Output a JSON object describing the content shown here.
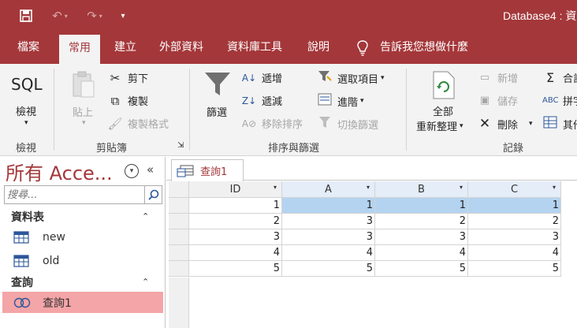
{
  "window": {
    "title": "Database4 : 資"
  },
  "quick_access": {
    "save_icon": "save-icon",
    "undo_icon": "undo-icon",
    "redo_icon": "redo-icon",
    "customize_icon": "customize-dropdown-icon"
  },
  "ribbon_tabs": [
    "檔案",
    "常用",
    "建立",
    "外部資料",
    "資料庫工具",
    "說明",
    "告訴我您想做什麼"
  ],
  "ribbon": {
    "views": {
      "line1": "SQL",
      "line2": "檢視",
      "group": "檢視"
    },
    "clipboard": {
      "paste": "貼上",
      "cut": "剪下",
      "copy": "複製",
      "format_painter": "複製格式",
      "group": "剪貼簿"
    },
    "sort_filter": {
      "filter": "篩選",
      "ascending": "遞增",
      "descending": "遞減",
      "remove_sort": "移除排序",
      "selection": "選取項目",
      "advanced": "進階",
      "toggle_filter": "切換篩選",
      "group": "排序與篩選"
    },
    "records": {
      "refresh_line1": "全部",
      "refresh_line2": "重新整理",
      "new": "新增",
      "save": "儲存",
      "delete": "刪除",
      "totals": "合計",
      "spelling": "拼字",
      "more": "其他",
      "group": "記錄"
    }
  },
  "nav": {
    "title": "所有 Acce...",
    "search_placeholder": "搜尋...",
    "sections": [
      {
        "label": "資料表",
        "items": [
          "new",
          "old"
        ]
      },
      {
        "label": "查詢",
        "items": [
          "查詢1"
        ]
      }
    ]
  },
  "doc_tab": {
    "label": "查詢1"
  },
  "datasheet": {
    "columns": [
      "ID",
      "A",
      "B",
      "C"
    ],
    "rows": [
      [
        "1",
        "1",
        "1",
        "1"
      ],
      [
        "2",
        "3",
        "2",
        "2"
      ],
      [
        "3",
        "3",
        "3",
        "3"
      ],
      [
        "4",
        "4",
        "4",
        "4"
      ],
      [
        "5",
        "5",
        "5",
        "5"
      ]
    ]
  },
  "colors": {
    "accent": "#A4373A",
    "selected_nav": "#F4A5A7",
    "cell_highlight": "#B4D3F0"
  }
}
